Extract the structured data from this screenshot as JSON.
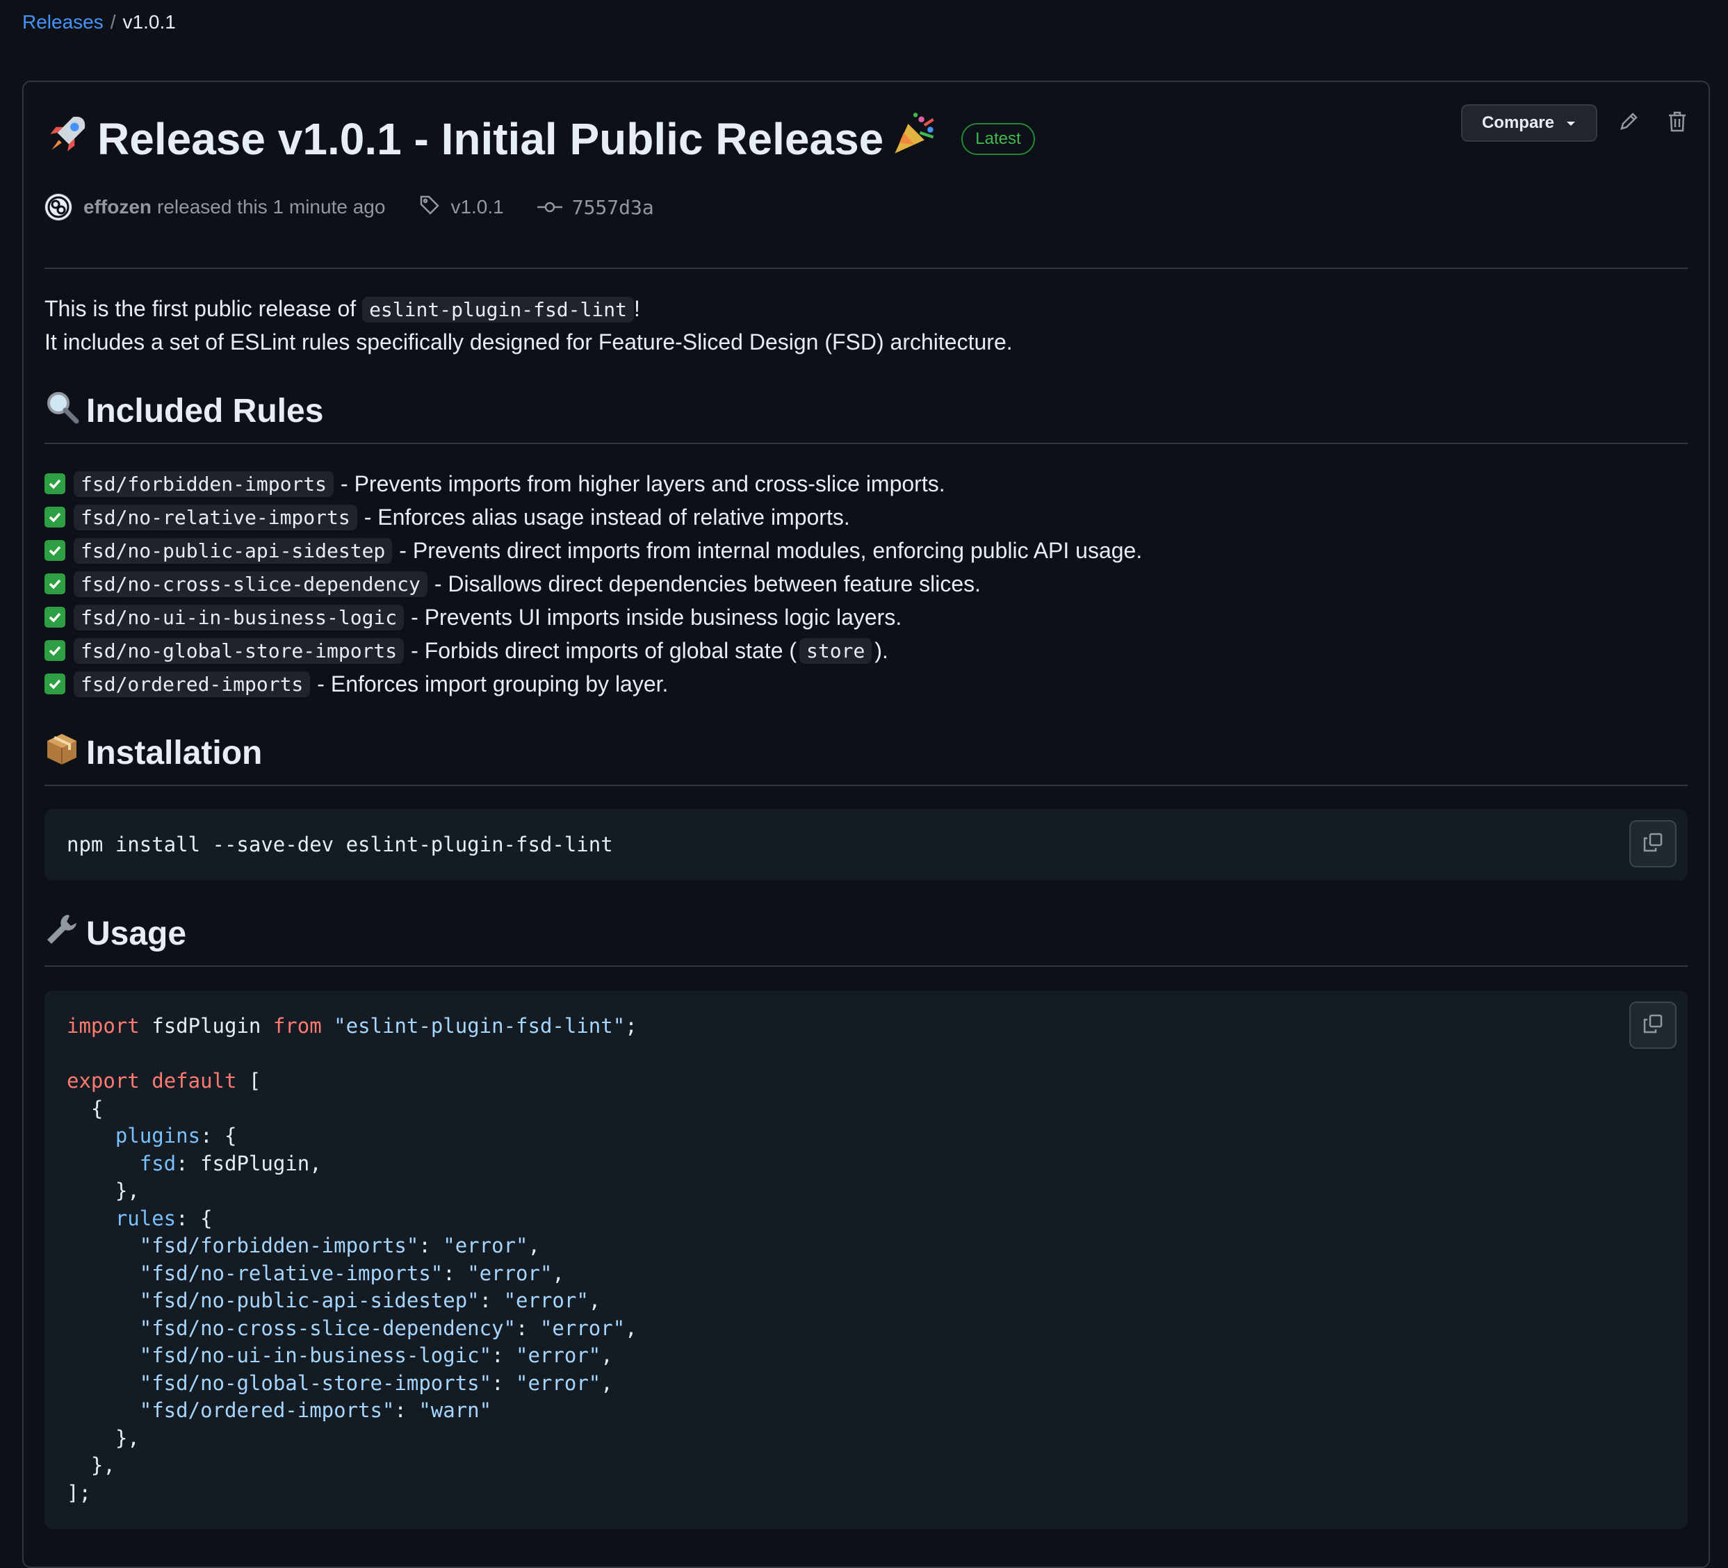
{
  "breadcrumb": {
    "releases": "Releases",
    "separator": "/",
    "current": "v1.0.1"
  },
  "release": {
    "title": "Release v1.0.1 - Initial Public Release",
    "badge": "Latest",
    "author": "effozen",
    "released_text": "released this 1 minute ago",
    "tag": "v1.0.1",
    "commit": "7557d3a"
  },
  "actions": {
    "compare_label": "Compare"
  },
  "intro": {
    "line1_before": "This is the first public release of",
    "package": "eslint-plugin-fsd-lint",
    "line1_after": "!",
    "line2": "It includes a set of ESLint rules specifically designed for Feature-Sliced Design (FSD) architecture."
  },
  "sections": {
    "rules_heading": "Included Rules",
    "install_heading": "Installation",
    "usage_heading": "Usage"
  },
  "rules": [
    {
      "name": "fsd/forbidden-imports",
      "desc": "- Prevents imports from higher layers and cross-slice imports."
    },
    {
      "name": "fsd/no-relative-imports",
      "desc": "- Enforces alias usage instead of relative imports."
    },
    {
      "name": "fsd/no-public-api-sidestep",
      "desc": "- Prevents direct imports from internal modules, enforcing public API usage."
    },
    {
      "name": "fsd/no-cross-slice-dependency",
      "desc": "- Disallows direct dependencies between feature slices."
    },
    {
      "name": "fsd/no-ui-in-business-logic",
      "desc": "- Prevents UI imports inside business logic layers."
    },
    {
      "name": "fsd/no-global-store-imports",
      "desc": "- Forbids direct imports of global state (",
      "code": "store",
      "desc_after": ")."
    },
    {
      "name": "fsd/ordered-imports",
      "desc": "- Enforces import grouping by layer."
    }
  ],
  "install": {
    "command": "npm install --save-dev eslint-plugin-fsd-lint"
  },
  "usage": {
    "import_kw": "import",
    "import_name": "fsdPlugin",
    "from_kw": "from",
    "import_src": "\"eslint-plugin-fsd-lint\"",
    "export_kw": "export",
    "default_kw": "default",
    "plugins_key": "plugins",
    "fsd_key": "fsd",
    "fsd_val": "fsdPlugin,",
    "rules_key": "rules",
    "rule_lines": [
      {
        "key": "\"fsd/forbidden-imports\"",
        "val": "\"error\"",
        "end": ","
      },
      {
        "key": "\"fsd/no-relative-imports\"",
        "val": "\"error\"",
        "end": ","
      },
      {
        "key": "\"fsd/no-public-api-sidestep\"",
        "val": "\"error\"",
        "end": ","
      },
      {
        "key": "\"fsd/no-cross-slice-dependency\"",
        "val": "\"error\"",
        "end": ","
      },
      {
        "key": "\"fsd/no-ui-in-business-logic\"",
        "val": "\"error\"",
        "end": ","
      },
      {
        "key": "\"fsd/no-global-store-imports\"",
        "val": "\"error\"",
        "end": ","
      },
      {
        "key": "\"fsd/ordered-imports\"",
        "val": "\"warn\"",
        "end": ""
      }
    ]
  },
  "icons": {
    "rocket": "rocket-icon",
    "party": "party-popper-icon",
    "magnifier": "magnifying-glass-icon",
    "package": "package-icon",
    "wrench": "wrench-icon",
    "check": "check-mark-icon",
    "tag": "tag-icon",
    "commit": "commit-icon",
    "pencil": "pencil-icon",
    "trash": "trash-icon",
    "copy": "copy-icon"
  },
  "colors": {
    "background": "#0d1117",
    "link": "#4493f8",
    "latest_badge": "#3fb950",
    "check": "#2ea043",
    "keyword": "#ff7b72",
    "string": "#a5d6ff",
    "property": "#79c0ff"
  }
}
